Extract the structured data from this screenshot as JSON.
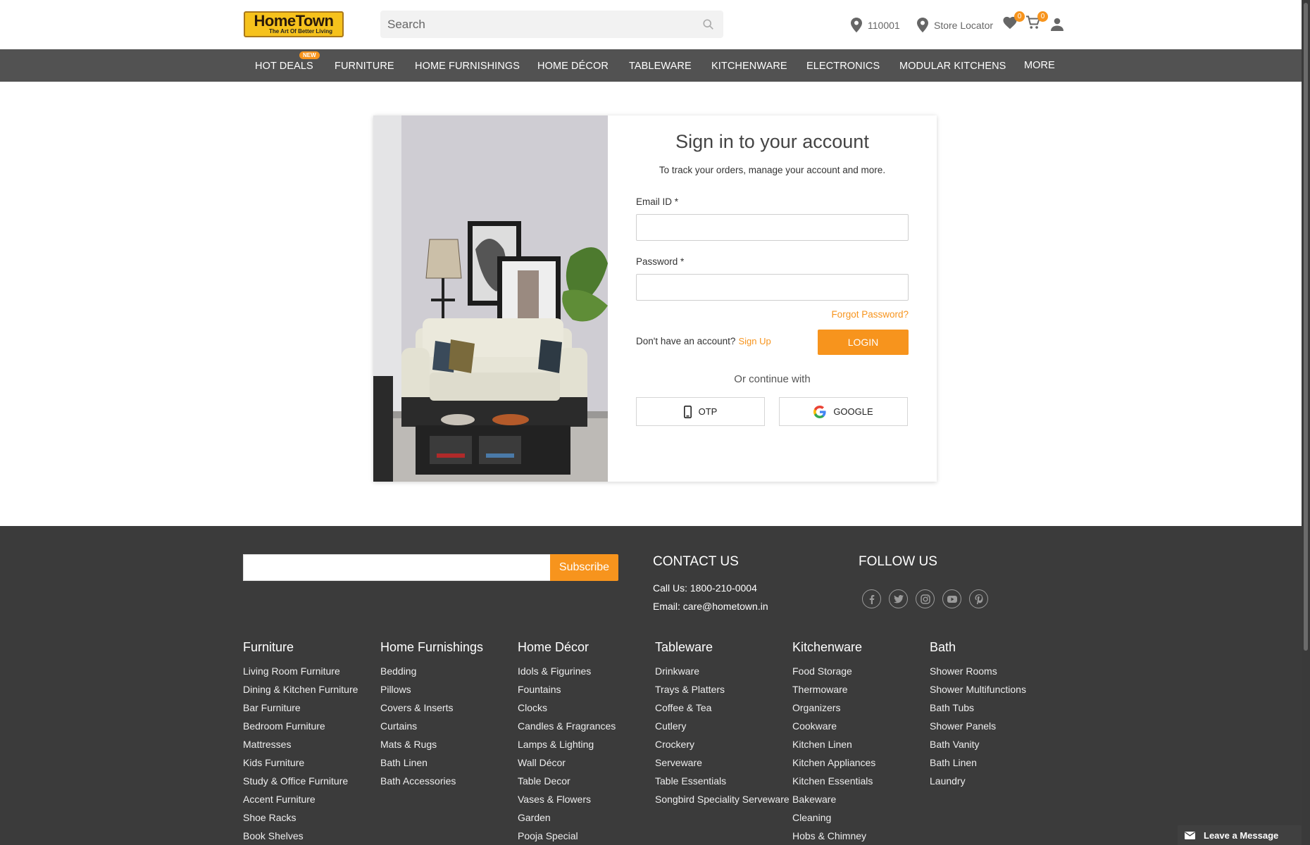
{
  "header": {
    "logo_main": "HomeTown",
    "logo_tagline": "The Art Of Better Living",
    "search_placeholder": "Search",
    "pincode": "110001",
    "store_locator": "Store Locator",
    "wishlist_count": "0",
    "cart_count": "0"
  },
  "nav": {
    "new_badge": "NEW",
    "items": [
      "HOT DEALS",
      "FURNITURE",
      "HOME FURNISHINGS",
      "HOME DÉCOR",
      "TABLEWARE",
      "KITCHENWARE",
      "ELECTRONICS",
      "MODULAR KITCHENS",
      "MORE"
    ]
  },
  "login": {
    "title": "Sign in to your account",
    "subtitle": "To track your orders, manage your account and more.",
    "email_label": "Email ID *",
    "password_label": "Password *",
    "forgot": "Forgot Password?",
    "no_account": "Don't have an account?",
    "sign_up": "Sign Up",
    "login_button": "LOGIN",
    "or_continue": "Or continue with",
    "otp_button": "OTP",
    "google_button": "GOOGLE"
  },
  "footer": {
    "subscribe_button": "Subscribe",
    "contact_title": "CONTACT US",
    "call": "Call Us: 1800-210-0004",
    "email": "Email: care@hometown.in",
    "follow_title": "FOLLOW US",
    "social_icons": [
      "facebook-icon",
      "twitter-icon",
      "instagram-icon",
      "youtube-icon",
      "pinterest-icon"
    ],
    "columns": [
      {
        "title": "Furniture",
        "links": [
          "Living Room Furniture",
          "Dining & Kitchen Furniture",
          "Bar Furniture",
          "Bedroom Furniture",
          "Mattresses",
          "Kids Furniture",
          "Study & Office Furniture",
          "Accent Furniture",
          "Shoe Racks",
          "Book Shelves"
        ]
      },
      {
        "title": "Home Furnishings",
        "links": [
          "Bedding",
          "Pillows",
          "Covers & Inserts",
          "Curtains",
          "Mats & Rugs",
          "Bath Linen",
          "Bath Accessories"
        ]
      },
      {
        "title": "Home Décor",
        "links": [
          "Idols & Figurines",
          "Fountains",
          "Clocks",
          "Candles & Fragrances",
          "Lamps & Lighting",
          "Wall Décor",
          "Table Decor",
          "Vases & Flowers",
          "Garden",
          "Pooja Special"
        ]
      },
      {
        "title": "Tableware",
        "links": [
          "Drinkware",
          "Trays & Platters",
          "Coffee & Tea",
          "Cutlery",
          "Crockery",
          "Serveware",
          "Table Essentials",
          "Songbird Speciality Serveware"
        ]
      },
      {
        "title": "Kitchenware",
        "links": [
          "Food Storage",
          "Thermoware",
          "Organizers",
          "Cookware",
          "Kitchen Linen",
          "Kitchen Appliances",
          "Kitchen Essentials",
          "Bakeware",
          "Cleaning",
          "Hobs & Chimney"
        ]
      },
      {
        "title": "Bath",
        "links": [
          "Shower Rooms",
          "Shower Multifunctions",
          "Bath Tubs",
          "Shower Panels",
          "Bath Vanity",
          "Bath Linen",
          "Laundry"
        ]
      }
    ],
    "leave_message": "Leave a Message"
  },
  "colors": {
    "accent": "#f7941d",
    "nav_bg": "#525252",
    "footer_bg": "#3b3b3b"
  }
}
